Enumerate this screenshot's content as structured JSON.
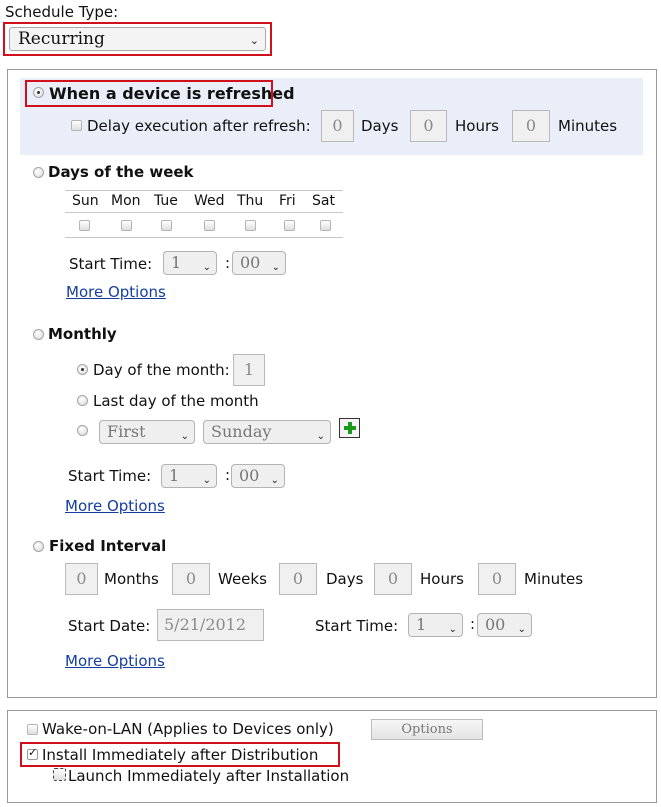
{
  "schedule": {
    "label": "Schedule Type:",
    "selected": "Recurring"
  },
  "refresh": {
    "label": "When a device is refreshed",
    "delay_label": "Delay execution after refresh:",
    "days_value": "0",
    "days_label": "Days",
    "hours_value": "0",
    "hours_label": "Hours",
    "minutes_value": "0",
    "minutes_label": "Minutes"
  },
  "weekly": {
    "label": "Days of the week",
    "days": [
      "Sun",
      "Mon",
      "Tue",
      "Wed",
      "Thu",
      "Fri",
      "Sat"
    ],
    "start_time_label": "Start Time:",
    "hour": "1",
    "minute": "00",
    "time_sep": ":",
    "more_options": "More Options"
  },
  "monthly": {
    "label": "Monthly",
    "day_of_month_label": "Day of the month:",
    "day_of_month_value": "1",
    "last_day_label": "Last day of the month",
    "ordinal": "First",
    "weekday": "Sunday",
    "start_time_label": "Start Time:",
    "hour": "1",
    "minute": "00",
    "time_sep": ":",
    "more_options": "More Options"
  },
  "fixed": {
    "label": "Fixed Interval",
    "months_value": "0",
    "months_label": "Months",
    "weeks_value": "0",
    "weeks_label": "Weeks",
    "days_value": "0",
    "days_label": "Days",
    "hours_value": "0",
    "hours_label": "Hours",
    "minutes_value": "0",
    "minutes_label": "Minutes",
    "start_date_label": "Start Date:",
    "start_date_value": "5/21/2012",
    "start_time_label": "Start Time:",
    "hour": "1",
    "minute": "00",
    "time_sep": ":",
    "more_options": "More Options"
  },
  "options": {
    "wol_label": "Wake-on-LAN (Applies to Devices only)",
    "options_button": "Options",
    "install_label": "Install Immediately after Distribution",
    "launch_label": "Launch Immediately after Installation"
  },
  "colors": {
    "highlight_border": "#d0101a",
    "link": "#153ea0",
    "selected_section_bg": "#e9eef8"
  }
}
